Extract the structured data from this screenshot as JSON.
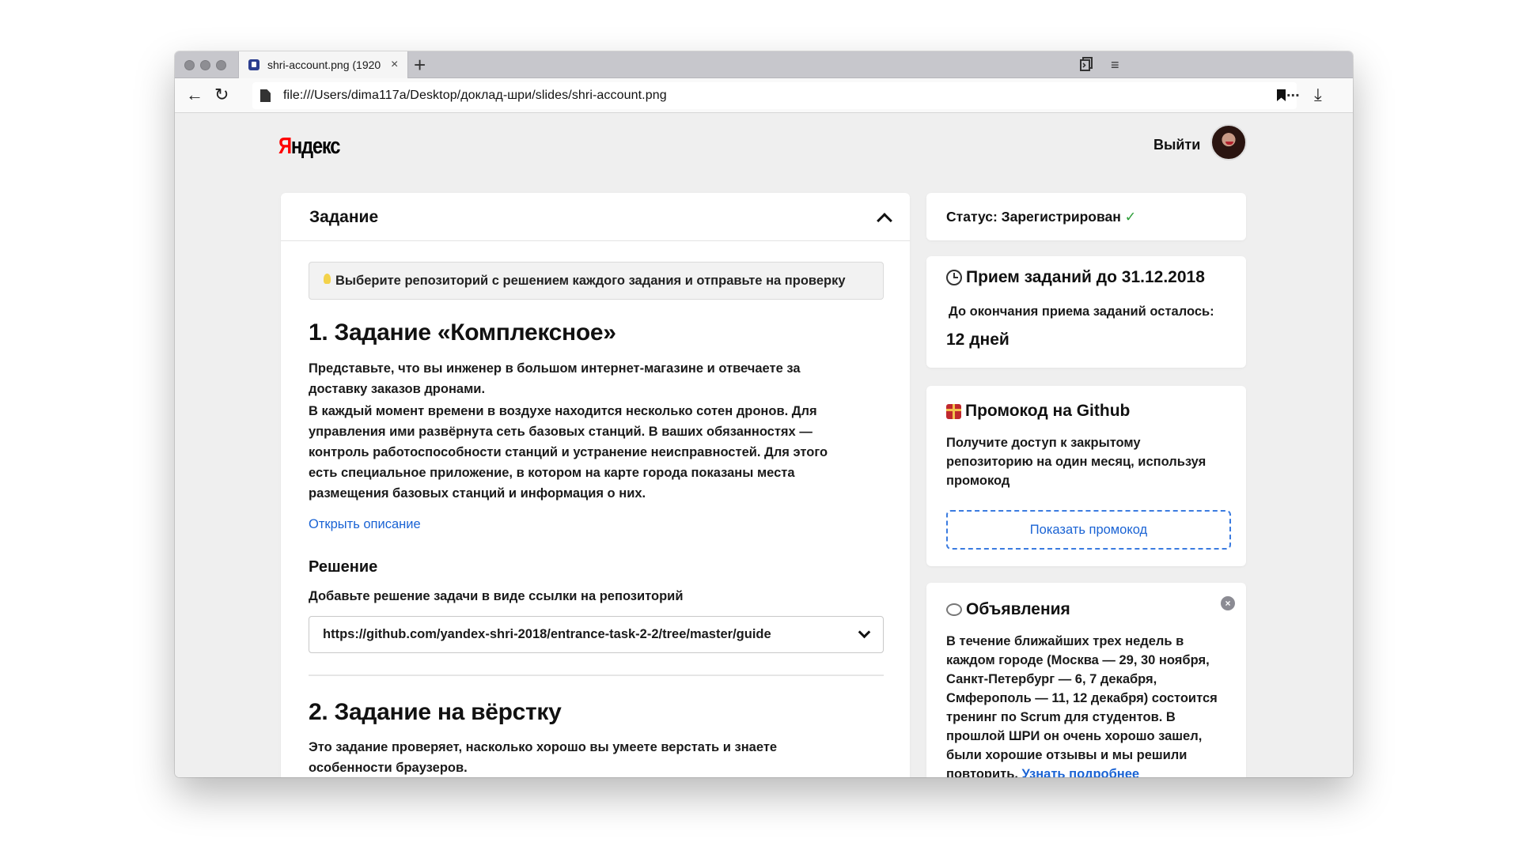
{
  "browser": {
    "tab_title": "shri-account.png (1920",
    "tab_close": "×",
    "new_tab": "+",
    "url": "file:///Users/dima117a/Desktop/доклад-шри/slides/shri-account.png",
    "back_glyph": "←",
    "reload_glyph": "↻",
    "menu_glyph": "≡",
    "more_glyph": "...",
    "download_glyph": "⤓",
    "icons": [
      "file-icon",
      "bookmark-icon",
      "tab-collection-icon",
      "hamburger-menu-icon",
      "download-icon"
    ]
  },
  "header": {
    "logo_first": "Я",
    "logo_rest": "ндекс",
    "logout": "Выйти"
  },
  "task": {
    "header_title": "Задание",
    "hint": "Выберите репозиторий с решением каждого задания и отправьте на проверку",
    "task1": {
      "title": "1. Задание «Комплексное»",
      "para1": "Представьте, что вы инженер в большом интернет-магазине и отвечаете за доставку заказов дронами.",
      "para2": "В каждый момент времени в воздухе находится несколько сотен дронов. Для управления ими развёрнута сеть базовых станций. В ваших обязанностях — контроль работоспособности станций и устранение неисправностей. Для этого есть специальное приложение, в котором на карте города показаны места размещения базовых станций и информация о них.",
      "open_description": "Открыть описание",
      "solution_title": "Решение",
      "solution_hint": "Добавьте решение задачи в виде ссылки на репозиторий",
      "selected_repo": "https://github.com/yandex-shri-2018/entrance-task-2-2/tree/master/guide"
    },
    "task2": {
      "title": "2. Задание на вёрстку",
      "para": "Это задание проверяет, насколько хорошо вы умеете верстать и знаете особенности браузеров."
    }
  },
  "sidebar": {
    "status_label": "Статус: Зарегистрирован",
    "status_check": "✓",
    "deadline": {
      "title": "Прием заданий до 31.12.2018",
      "subtitle": "До окончания приема заданий осталось:",
      "remaining": "12 дней"
    },
    "promo": {
      "title": "Промокод на Github",
      "text": "Получите доступ к закрытому репозиторию на один месяц, используя промокод",
      "button": "Показать промокод"
    },
    "news": {
      "title": "Объявления",
      "close": "×",
      "text": "В течение ближайших трех недель в каждом городе (Москва — 29, 30 ноября, Санкт-Петербург — 6, 7 декабря, Смферополь — 11, 12 декабря) состоится тренинг по Scrum для студентов. В прошлой ШРИ он очень хорошо зашел, были хорошие отзывы и мы решили повторить.",
      "link": "Узнать подробнее"
    }
  },
  "colors": {
    "link": "#1a63d4",
    "brand_red": "#ff0000",
    "status_green": "#2e9e3a"
  }
}
